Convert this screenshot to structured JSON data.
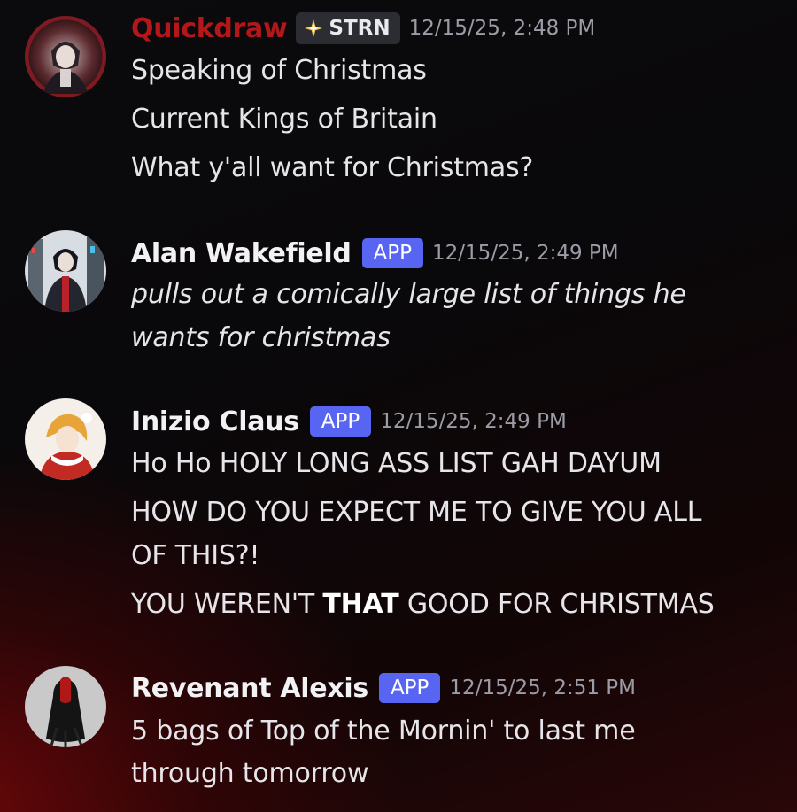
{
  "messages": [
    {
      "username": "Quickdraw",
      "tag": "STRN",
      "timestamp": "12/15/25, 2:48 PM",
      "lines": [
        "Speaking of Christmas",
        "Current Kings of Britain",
        "What y'all want for Christmas?"
      ]
    },
    {
      "username": "Alan Wakefield",
      "badge": "APP",
      "timestamp": "12/15/25, 2:49 PM",
      "lines": [
        "pulls out a comically large list of things he",
        "wants for christmas"
      ]
    },
    {
      "username": "Inizio Claus",
      "badge": "APP",
      "timestamp": "12/15/25, 2:49 PM",
      "lines": [
        "Ho Ho HOLY LONG ASS LIST GAH DAYUM",
        "HOW DO YOU EXPECT ME TO GIVE YOU ALL",
        "OF THIS?!"
      ],
      "last_line": {
        "before": "YOU WEREN'T ",
        "bold": "THAT",
        "after": " GOOD FOR CHRISTMAS"
      }
    },
    {
      "username": "Revenant Alexis",
      "badge": "APP",
      "timestamp": "12/15/25, 2:51 PM",
      "lines": [
        "5 bags of Top of the Mornin' to last me",
        "through tomorrow"
      ]
    }
  ],
  "icons": {
    "tag_icon": "sparkle-icon",
    "colors": {
      "accent": "#5865f2",
      "quickdraw_name": "#b3171a",
      "timestamp": "#9c9ca6"
    }
  }
}
